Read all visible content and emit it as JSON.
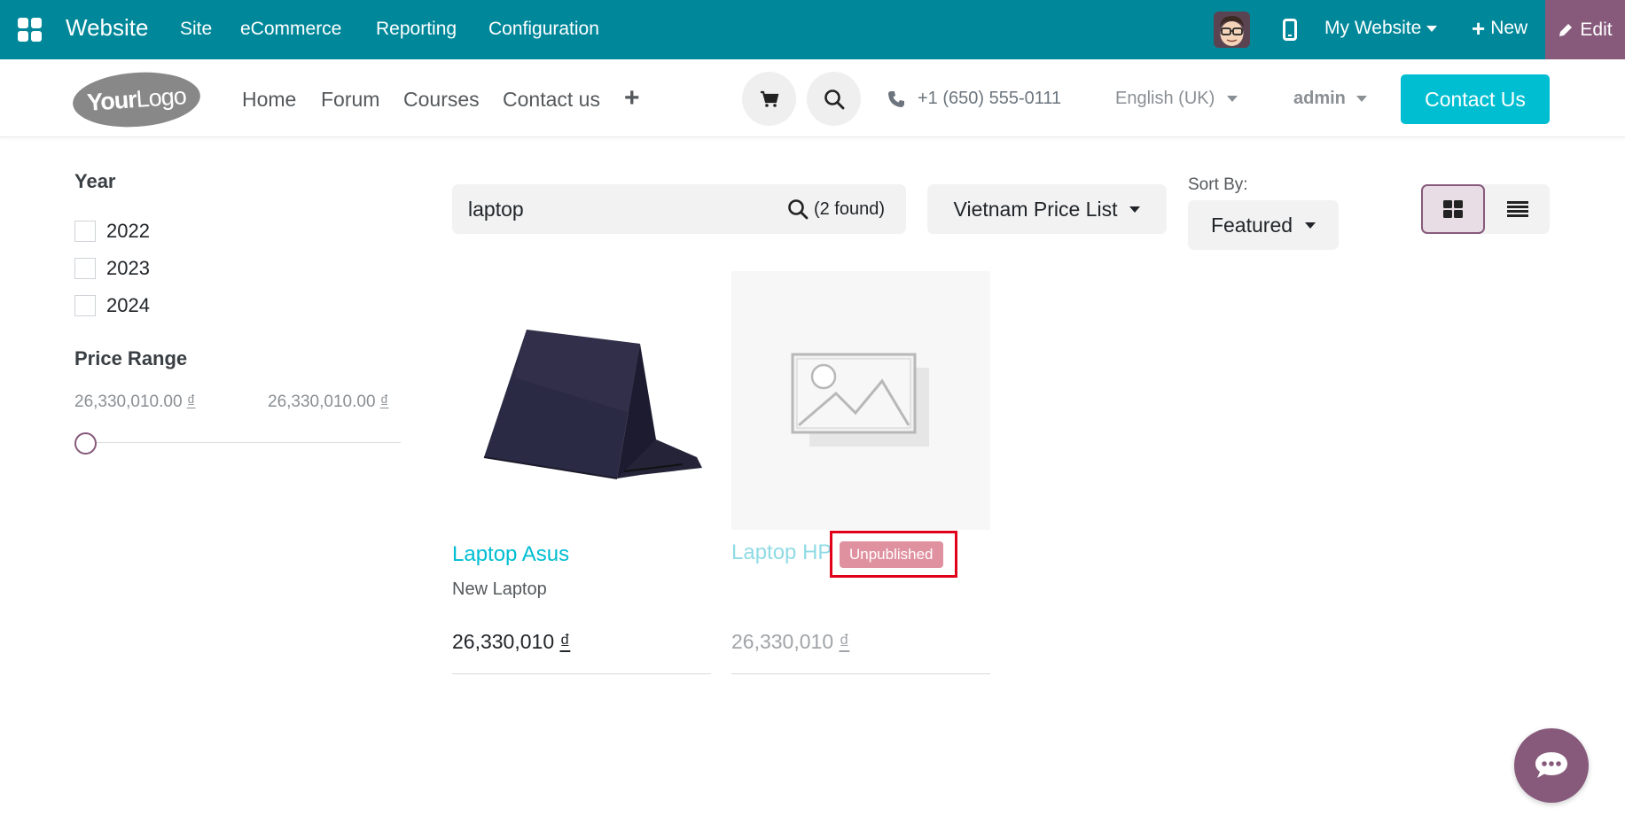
{
  "topbar": {
    "brand": "Website",
    "menus": [
      "Site",
      "eCommerce",
      "Reporting",
      "Configuration"
    ],
    "website_selector": "My Website",
    "new_label": "New",
    "edit_label": "Edit"
  },
  "header": {
    "logo_text_bold": "Your",
    "logo_text": "Logo",
    "nav": [
      "Home",
      "Forum",
      "Courses",
      "Contact us"
    ],
    "phone": "+1 (650) 555-0111",
    "language": "English (UK)",
    "user": "admin",
    "contact_button": "Contact Us"
  },
  "filters": {
    "year_title": "Year",
    "years": [
      "2022",
      "2023",
      "2024"
    ],
    "price_title": "Price Range",
    "price_min": "26,330,010.00",
    "price_max": "26,330,010.00",
    "currency": "₫"
  },
  "toolbar": {
    "search_value": "laptop",
    "found": "(2 found)",
    "pricelist": "Vietnam Price List",
    "sort_label": "Sort By:",
    "sort_value": "Featured"
  },
  "products": [
    {
      "name": "Laptop Asus",
      "description": "New Laptop",
      "price": "26,330,010",
      "currency": "₫"
    },
    {
      "name": "Laptop HP",
      "badge": "Unpublished",
      "price": "26,330,010",
      "currency": "₫"
    }
  ],
  "colors": {
    "topbar": "#00889a",
    "edit": "#875a7b",
    "accent": "#00bed1",
    "badge": "#e0919f",
    "highlight": "#e0001a"
  }
}
